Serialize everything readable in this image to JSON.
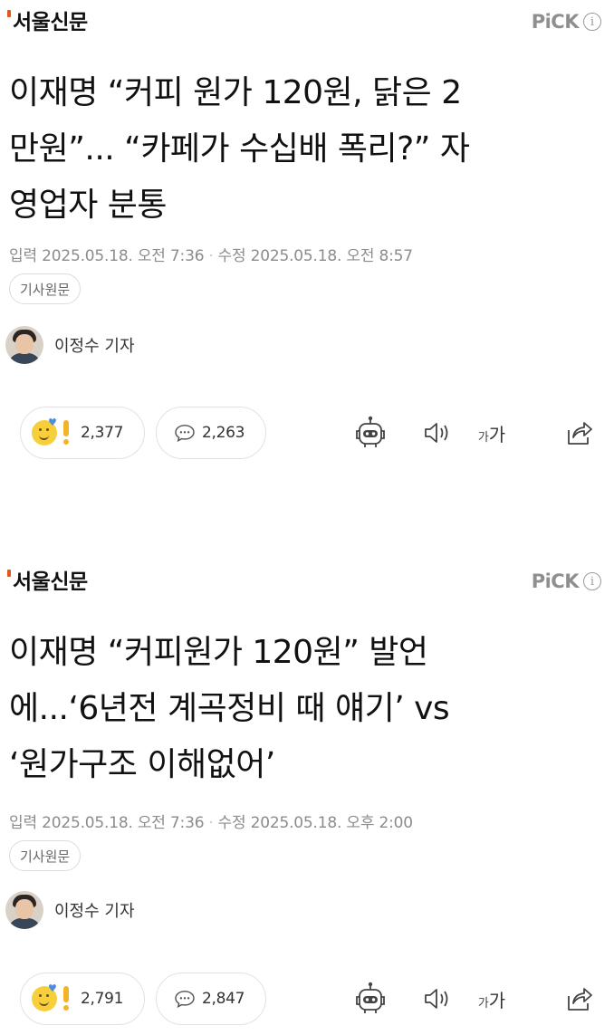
{
  "articles": [
    {
      "press": "서울신문",
      "pick": "PiCK",
      "info": "i",
      "headline_lines": [
        "이재명 “커피 원가 120원, 닭은 2",
        "만원”... “카페가 수십배 폭리?” 자",
        "영업자 분통"
      ],
      "dateline": {
        "input_label": "입력",
        "input": "2025.05.18. 오전 7:36",
        "modified_label": "수정",
        "modified": "2025.05.18. 오전 8:57"
      },
      "original_button": "기사원문",
      "reporter": "이정수 기자",
      "reactions": "2,377",
      "comments": "2,263",
      "font_button": {
        "small": "가",
        "big": "가"
      }
    },
    {
      "press": "서울신문",
      "pick": "PiCK",
      "info": "i",
      "headline_lines": [
        "이재명 “커피원가 120원” 발언",
        "에...‘6년전 계곡정비 때 얘기’ vs",
        "‘원가구조 이해없어’"
      ],
      "dateline": {
        "input_label": "입력",
        "input": "2025.05.18. 오전 7:36",
        "modified_label": "수정",
        "modified": "2025.05.18. 오후 2:00"
      },
      "original_button": "기사원문",
      "reporter": "이정수 기자",
      "reactions": "2,791",
      "comments": "2,847",
      "font_button": {
        "small": "가",
        "big": "가"
      }
    }
  ],
  "icons": [
    "press-mark-icon",
    "info-icon",
    "avatar",
    "emoji-smile-icon",
    "heart-icon",
    "exclamation-icon",
    "comment-bubble-icon",
    "robot-summary-icon",
    "speaker-icon",
    "font-size-icon",
    "share-icon"
  ],
  "colors": {
    "accent": "#e2561f",
    "muted": "#8c8c8c",
    "border": "#e2e2e2"
  }
}
